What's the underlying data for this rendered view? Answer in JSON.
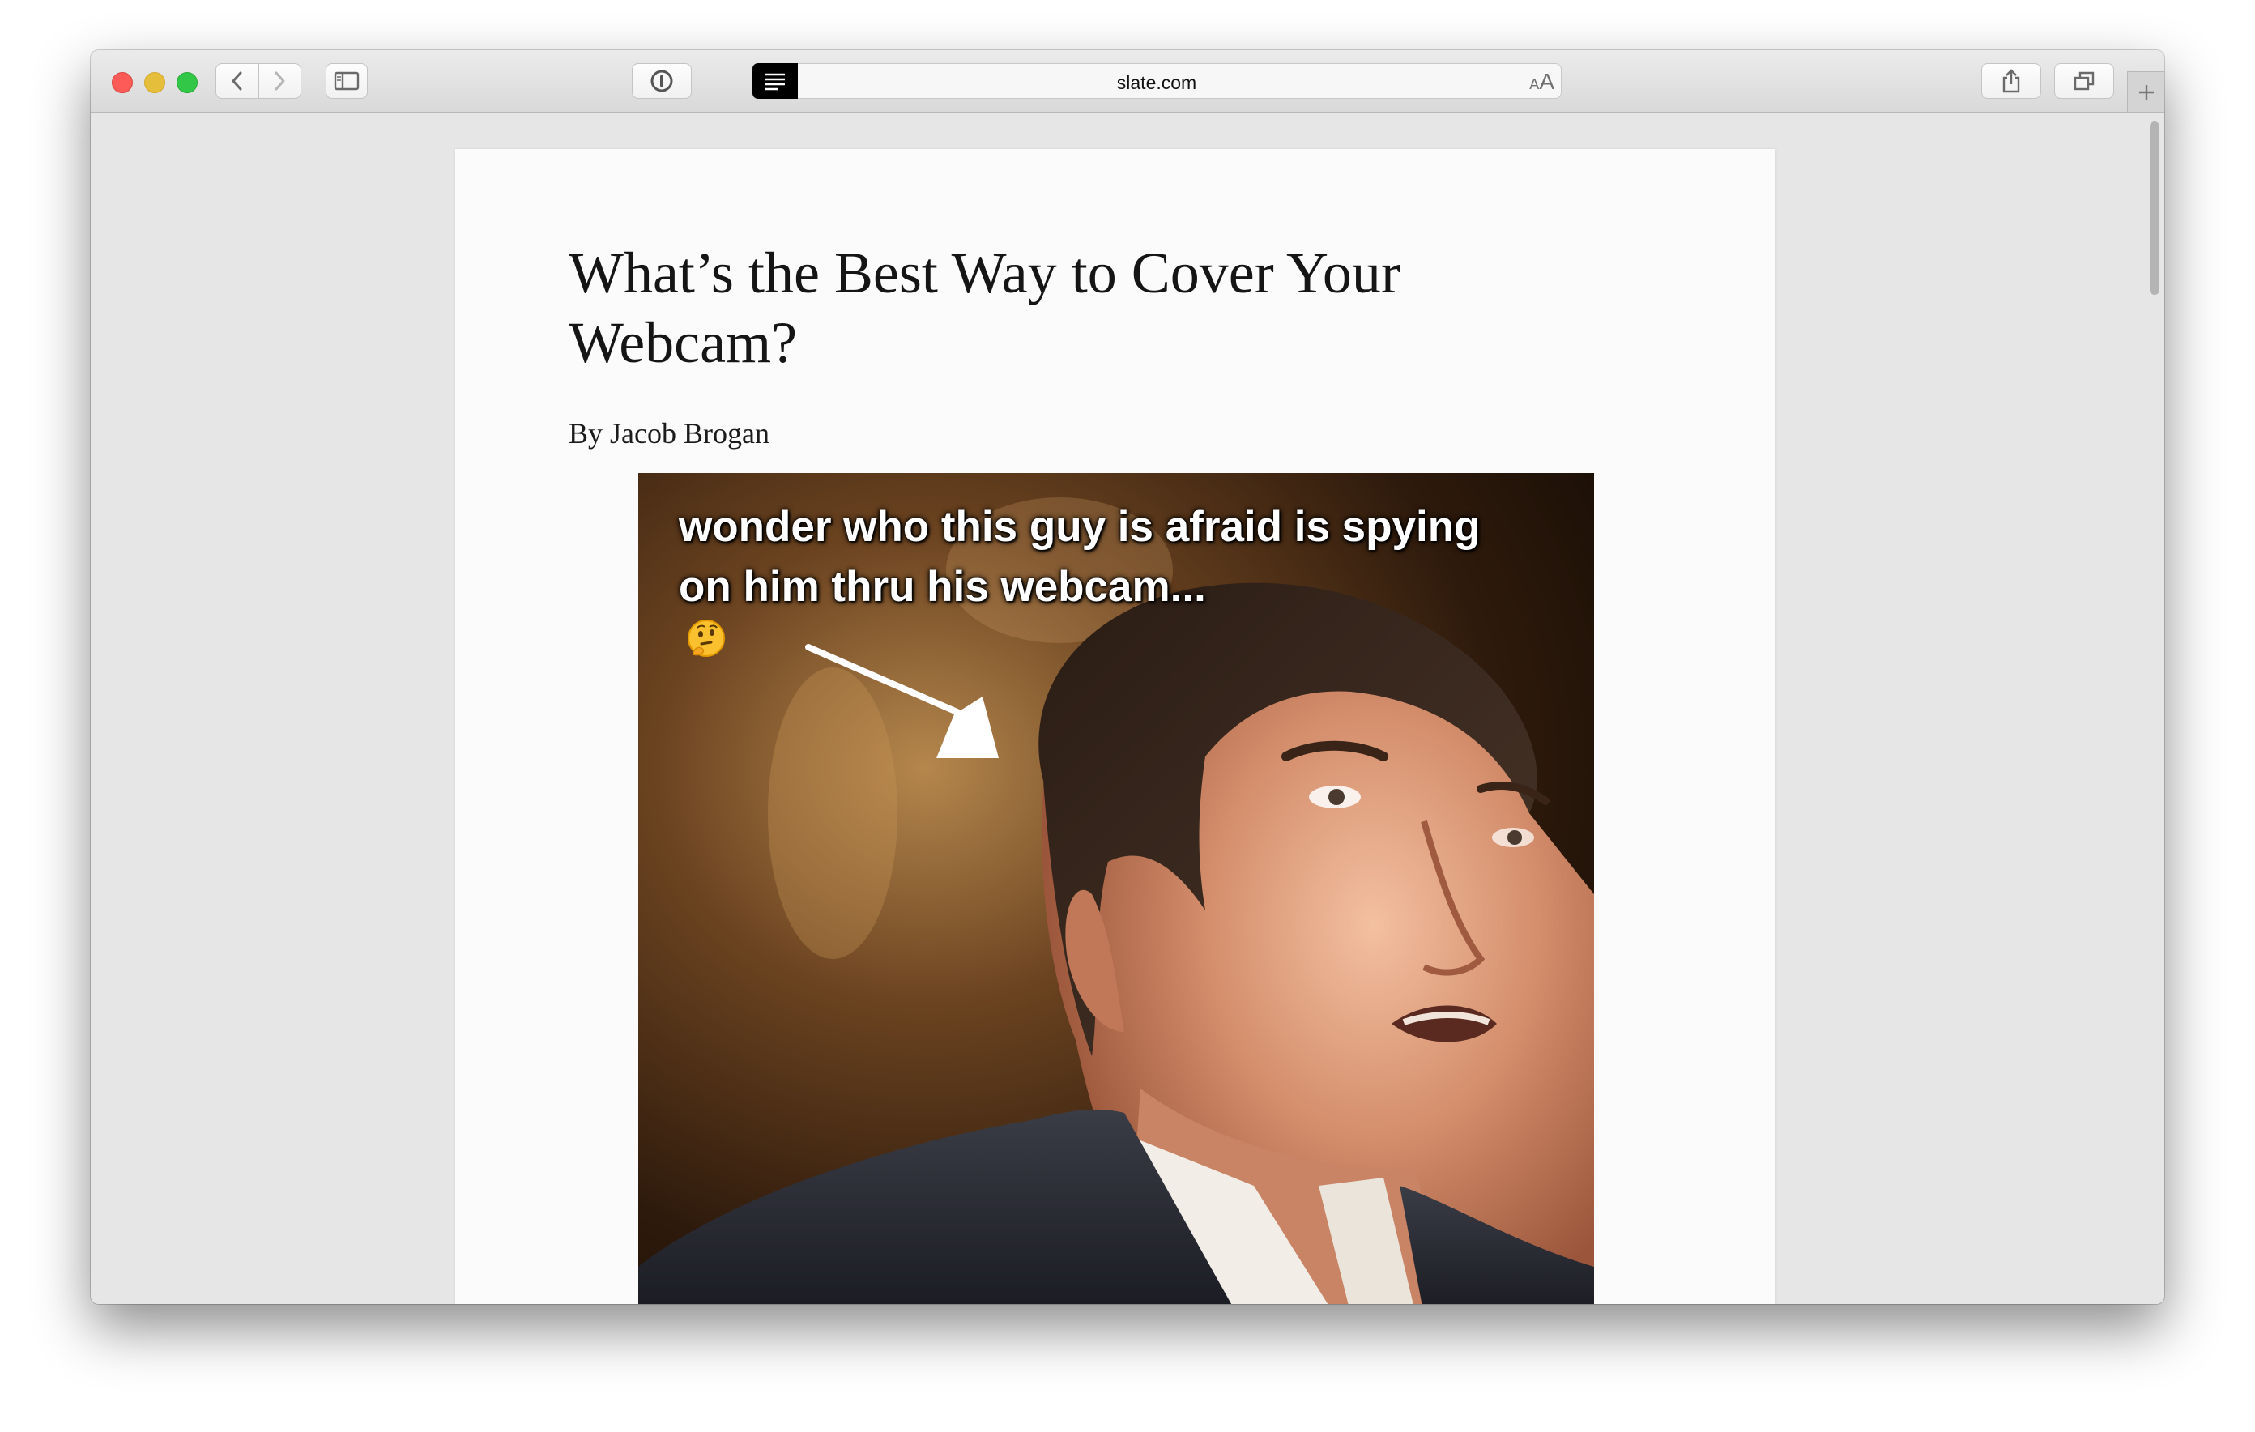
{
  "browser": {
    "url": "slate.com",
    "text_size_small": "A",
    "text_size_large": "A"
  },
  "article": {
    "title": "What’s the Best Way to Cover Your Webcam?",
    "byline": "By Jacob Brogan"
  },
  "hero_image": {
    "caption": "wonder who this guy is afraid is spying on him thru his webcam...",
    "caption_emoji": "thinking-face"
  },
  "colors": {
    "close": "#fc5b57",
    "minimize": "#e5bf3c",
    "maximize": "#33c748",
    "reader_button": "#000000",
    "page_background": "#fbfbfb"
  },
  "icons": [
    "back-chevron-icon",
    "forward-chevron-icon",
    "sidebar-icon",
    "password-key-icon",
    "reader-view-icon",
    "share-icon",
    "tabs-overview-icon",
    "plus-icon"
  ]
}
